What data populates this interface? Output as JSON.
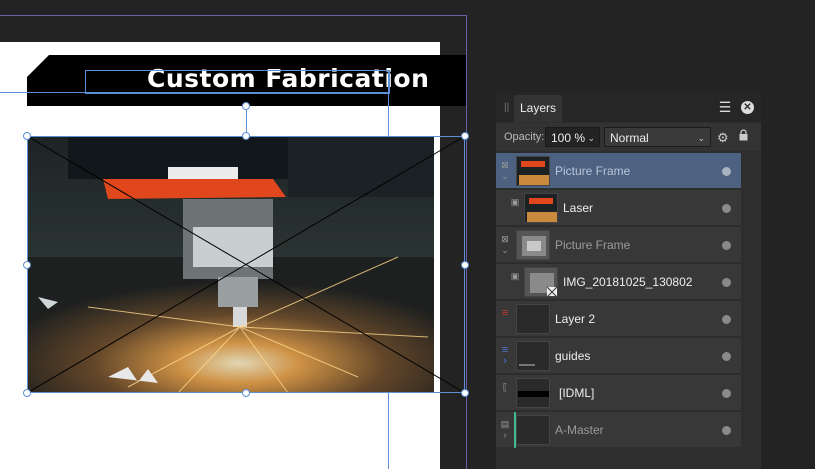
{
  "document": {
    "banner_title": "Custom Fabrication"
  },
  "layers_panel": {
    "tab_label": "Layers",
    "opacity_label": "Opacity:",
    "opacity_value": "100 %",
    "blend_mode": "Normal",
    "layers": [
      {
        "name": "Picture Frame",
        "selected": true,
        "dimmed": true,
        "indent": 0,
        "type": "picture-frame"
      },
      {
        "name": "Laser",
        "selected": false,
        "dimmed": false,
        "indent": 1,
        "type": "image"
      },
      {
        "name": "Picture Frame",
        "selected": false,
        "dimmed": true,
        "indent": 0,
        "type": "picture-frame"
      },
      {
        "name": "IMG_20181025_130802",
        "selected": false,
        "dimmed": false,
        "indent": 1,
        "type": "image"
      },
      {
        "name": "Layer 2",
        "selected": false,
        "dimmed": false,
        "indent": 0,
        "type": "layer"
      },
      {
        "name": "guides",
        "selected": false,
        "dimmed": false,
        "indent": 0,
        "type": "layer"
      },
      {
        "name": "[IDML]",
        "selected": false,
        "dimmed": false,
        "indent": 0,
        "type": "group"
      },
      {
        "name": "A-Master",
        "selected": false,
        "dimmed": true,
        "indent": 0,
        "type": "master"
      }
    ]
  },
  "colors": {
    "selection": "#5b8fd6",
    "selected_row": "#4d6180",
    "layer2_icon": "#c0392b",
    "guides_icon": "#4a78d4",
    "master_bar": "#3dbb8a"
  }
}
